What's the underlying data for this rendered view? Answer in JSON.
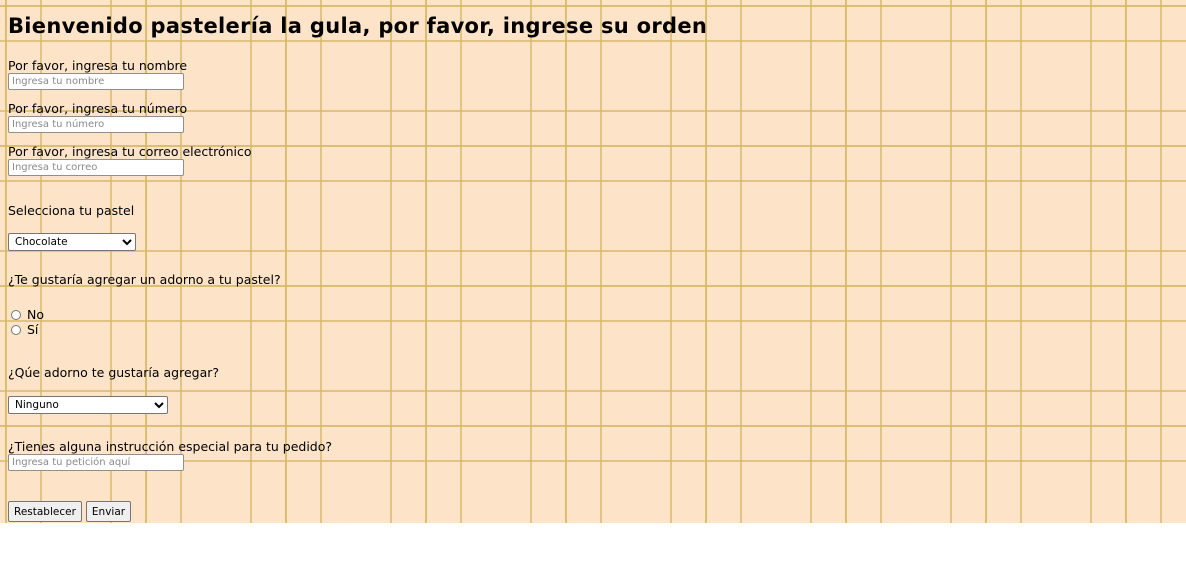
{
  "title": "Bienvenido pastelería la gula, por favor, ingrese su orden",
  "fields": {
    "name_label": "Por favor, ingresa tu nombre",
    "name_placeholder": "Ingresa tu nombre",
    "number_label": "Por favor, ingresa tu número",
    "number_placeholder": "Ingresa tu número",
    "email_label": "Por favor, ingresa tu correo electrónico",
    "email_placeholder": "Ingresa tu correo"
  },
  "cake": {
    "label": "Selecciona tu pastel",
    "selected": "Chocolate"
  },
  "decoration_question": {
    "label": "¿Te gustaría agregar un adorno a tu pastel?",
    "options": [
      "No",
      "Sí"
    ]
  },
  "decoration_choice": {
    "label": "¿Qúe adorno te gustaría agregar?",
    "selected": "Ninguno"
  },
  "instructions": {
    "label": "¿Tienes alguna instrucción especial para tu pedido?",
    "placeholder": "Ingresa tu petición aquí"
  },
  "buttons": {
    "reset": "Restablecer",
    "submit": "Enviar"
  },
  "colors": {
    "background": "#fde4c9",
    "pattern": "#d6b762"
  }
}
